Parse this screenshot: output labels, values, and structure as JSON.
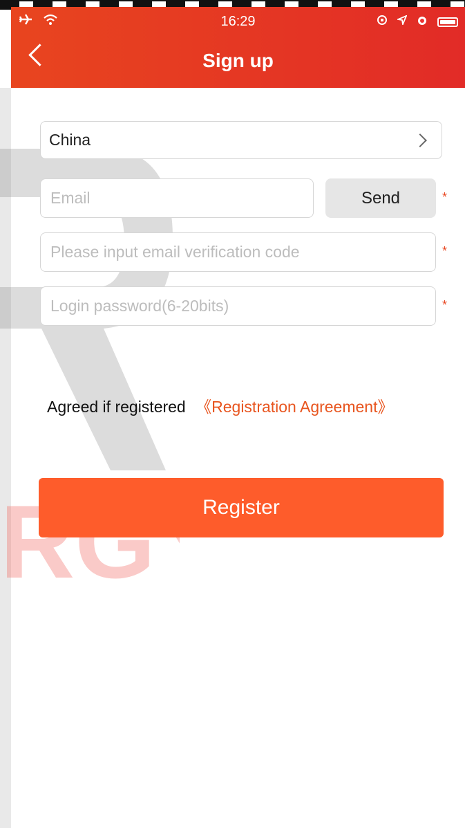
{
  "status_bar": {
    "time": "16:29"
  },
  "header": {
    "title": "Sign up"
  },
  "form": {
    "country": "China",
    "email_placeholder": "Email",
    "send_label": "Send",
    "code_placeholder": "Please input email verification code",
    "password_placeholder": "Login password(6-20bits)",
    "required_mark": "*"
  },
  "agreement": {
    "text": "Agreed if registered",
    "link": "《Registration Agreement》"
  },
  "register_label": "Register",
  "colors": {
    "header": "#e5392a",
    "accent": "#fe5c2b"
  },
  "icons": [
    "airplane-icon",
    "wifi-icon",
    "lock-rotation-icon",
    "location-icon",
    "alarm-icon",
    "battery-icon",
    "back-chevron-icon",
    "chevron-right-icon"
  ]
}
